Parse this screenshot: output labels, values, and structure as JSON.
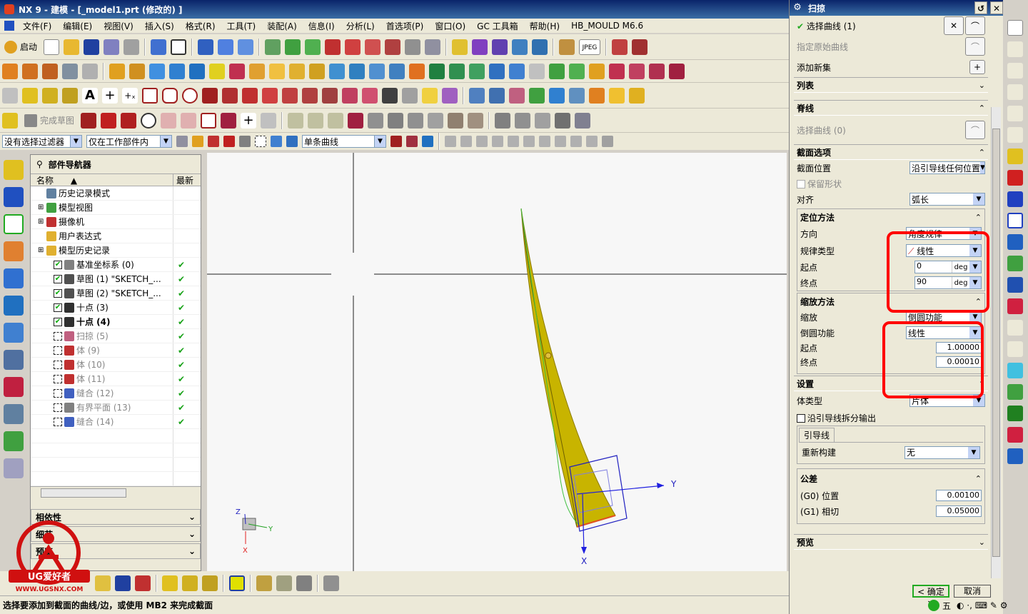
{
  "window": {
    "title": "NX 9 - 建模 - [_model1.prt (修改的) ]"
  },
  "menu": [
    "文件(F)",
    "编辑(E)",
    "视图(V)",
    "插入(S)",
    "格式(R)",
    "工具(T)",
    "装配(A)",
    "信息(I)",
    "分析(L)",
    "首选项(P)",
    "窗口(O)",
    "GC 工具箱",
    "帮助(H)",
    "HB_MOULD M6.6"
  ],
  "toolbar": {
    "start_label": "启动",
    "sketch_finish": "完成草图",
    "jpeg": "JPEG"
  },
  "filter": {
    "selection_filter": "没有选择过滤器",
    "scope": "仅在工作部件内",
    "curve_rule": "单条曲线"
  },
  "navigator": {
    "title": "部件导航器",
    "col_name": "名称",
    "col_latest": "最新",
    "items": [
      {
        "label": "历史记录模式",
        "indent": 1,
        "latest": "",
        "gray": false
      },
      {
        "label": "模型视图",
        "indent": 1,
        "latest": "",
        "gray": false
      },
      {
        "label": "摄像机",
        "indent": 1,
        "latest": "",
        "gray": false
      },
      {
        "label": "用户表达式",
        "indent": 1,
        "latest": "",
        "gray": false
      },
      {
        "label": "模型历史记录",
        "indent": 1,
        "latest": "",
        "gray": false
      },
      {
        "label": "基准坐标系 (0)",
        "indent": 2,
        "latest": "✔",
        "gray": false
      },
      {
        "label": "草图 (1) \"SKETCH_...",
        "indent": 2,
        "latest": "✔",
        "gray": false
      },
      {
        "label": "草图 (2) \"SKETCH_...",
        "indent": 2,
        "latest": "✔",
        "gray": false
      },
      {
        "label": "十点 (3)",
        "indent": 2,
        "latest": "✔",
        "gray": false
      },
      {
        "label": "十点 (4)",
        "indent": 2,
        "latest": "✔",
        "gray": false
      },
      {
        "label": "扫掠 (5)",
        "indent": 2,
        "latest": "✔",
        "gray": true
      },
      {
        "label": "体 (9)",
        "indent": 2,
        "latest": "✔",
        "gray": true
      },
      {
        "label": "体 (10)",
        "indent": 2,
        "latest": "✔",
        "gray": true
      },
      {
        "label": "体 (11)",
        "indent": 2,
        "latest": "✔",
        "gray": true
      },
      {
        "label": "缝合 (12)",
        "indent": 2,
        "latest": "✔",
        "gray": true
      },
      {
        "label": "有界平面 (13)",
        "indent": 2,
        "latest": "✔",
        "gray": true
      },
      {
        "label": "缝合 (14)",
        "indent": 2,
        "latest": "✔",
        "gray": true
      }
    ],
    "panels": [
      "相依性",
      "细节",
      "预览"
    ]
  },
  "status": {
    "text": "选择要添加到截面的曲线/边，或使用 MB2 来完成截面"
  },
  "viewport": {
    "axis_x": "X",
    "axis_y": "Y",
    "axis_z": "Z"
  },
  "watermark": {
    "brand": "UG爱好者",
    "url": "WWW.UGSNX.COM"
  },
  "ime": {
    "text": "五"
  },
  "dialog": {
    "title": "扫掠",
    "select_curve": "选择曲线 (1)",
    "specify_origin": "指定原始曲线",
    "add_new_set": "添加新集",
    "list": "列表",
    "spine": {
      "title": "脊线",
      "select_curve": "选择曲线 (0)"
    },
    "section_options": {
      "title": "截面选项",
      "position_label": "截面位置",
      "position_value": "沿引导线任何位置",
      "preserve_shape": "保留形状",
      "align_label": "对齐",
      "align_value": "弧长"
    },
    "orientation": {
      "title": "定位方法",
      "direction_label": "方向",
      "direction_value": "角度规律",
      "law_type_label": "规律类型",
      "law_type_value": "线性",
      "start_label": "起点",
      "start_value": "0",
      "end_label": "终点",
      "end_value": "90",
      "unit": "deg"
    },
    "scaling": {
      "title": "缩放方法",
      "scale_label": "缩放",
      "scale_value": "倒圆功能",
      "blend_label": "倒圆功能",
      "blend_value": "线性",
      "start_label": "起点",
      "start_value": "1.00000",
      "end_label": "终点",
      "end_value": "0.00010"
    },
    "settings": {
      "title": "设置",
      "body_type_label": "体类型",
      "body_type_value": "片体",
      "split_output": "沿引导线拆分输出",
      "guide_tab": "引导线",
      "rebuild_label": "重新构建",
      "rebuild_value": "无",
      "tolerance_title": "公差",
      "g0_label": "(G0) 位置",
      "g0_value": "0.00100",
      "g1_label": "(G1) 相切",
      "g1_value": "0.05000"
    },
    "preview": "预览",
    "ok": "< 确定 >",
    "cancel": "取消"
  },
  "colors": {
    "accent_red": "#ff0000",
    "surface": "#c8b400",
    "title_blue": "#0a246a"
  }
}
